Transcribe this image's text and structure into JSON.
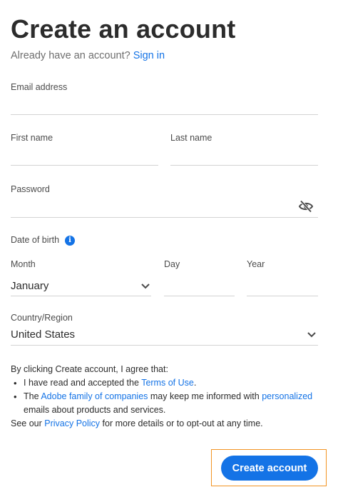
{
  "header": {
    "title": "Create an account",
    "signin_prompt": "Already have an account?",
    "signin_link": "Sign in"
  },
  "form": {
    "email_label": "Email address",
    "email_value": "",
    "first_name_label": "First name",
    "first_name_value": "",
    "last_name_label": "Last name",
    "last_name_value": "",
    "password_label": "Password",
    "password_value": "",
    "dob_label": "Date of birth",
    "month_label": "Month",
    "month_value": "January",
    "day_label": "Day",
    "day_value": "",
    "year_label": "Year",
    "year_value": "",
    "country_label": "Country/Region",
    "country_value": "United States"
  },
  "terms": {
    "intro": "By clicking Create account, I agree that:",
    "item1_pre": "I have read and accepted the ",
    "item1_link": "Terms of Use",
    "item1_post": ".",
    "item2_pre": "The ",
    "item2_link1": "Adobe family of companies",
    "item2_mid": " may keep me informed with ",
    "item2_link2": "personalized",
    "item2_post": " emails about products and services.",
    "footer_pre": "See our ",
    "footer_link": "Privacy Policy",
    "footer_post": " for more details or to opt-out at any time."
  },
  "actions": {
    "create_button": "Create account"
  },
  "colors": {
    "accent": "#1473e6",
    "focus_ring": "#f29423"
  }
}
